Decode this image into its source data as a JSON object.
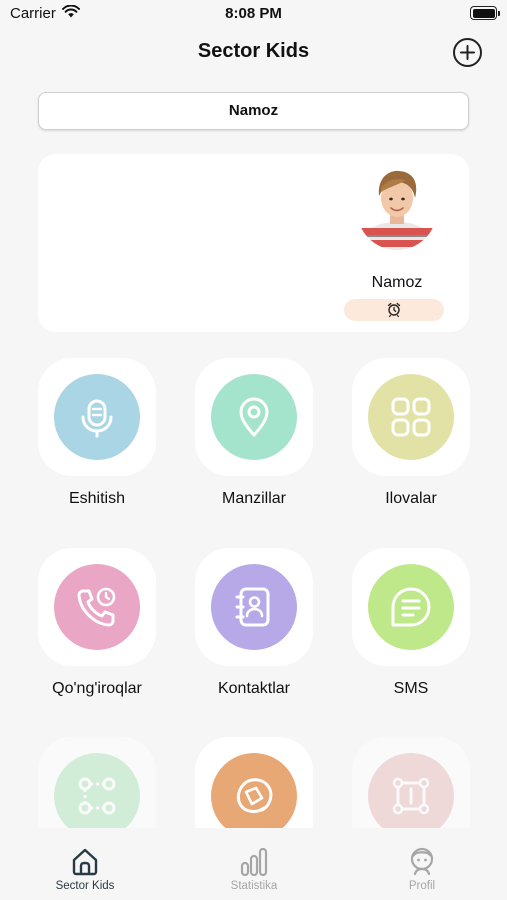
{
  "status": {
    "carrier": "Carrier",
    "time": "8:08 PM"
  },
  "header": {
    "title": "Sector Kids"
  },
  "child_selector": {
    "value": "Namoz"
  },
  "child_card": {
    "name": "Namoz"
  },
  "features": [
    {
      "label": "Eshitish",
      "color": "#a9d5e5",
      "icon": "microphone-icon"
    },
    {
      "label": "Manzillar",
      "color": "#a4e3cc",
      "icon": "location-pin-icon"
    },
    {
      "label": "Ilovalar",
      "color": "#e2e2a6",
      "icon": "apps-grid-icon"
    },
    {
      "label": "Qo'ng'iroqlar",
      "color": "#e9a6c5",
      "icon": "phone-clock-icon"
    },
    {
      "label": "Kontaktlar",
      "color": "#b7a8e8",
      "icon": "contacts-book-icon"
    },
    {
      "label": "SMS",
      "color": "#bfe88a",
      "icon": "message-icon"
    },
    {
      "color": "#a8e4b3",
      "icon": "route-icon"
    },
    {
      "color": "#e8a876",
      "icon": "rotate-icon"
    },
    {
      "color": "#e8b4b4",
      "icon": "geofence-icon"
    }
  ],
  "tabs": [
    {
      "label": "Sector Kids",
      "icon": "home-icon",
      "active": true
    },
    {
      "label": "Statistika",
      "icon": "bar-chart-icon",
      "active": false
    },
    {
      "label": "Profil",
      "icon": "profile-icon",
      "active": false
    }
  ]
}
